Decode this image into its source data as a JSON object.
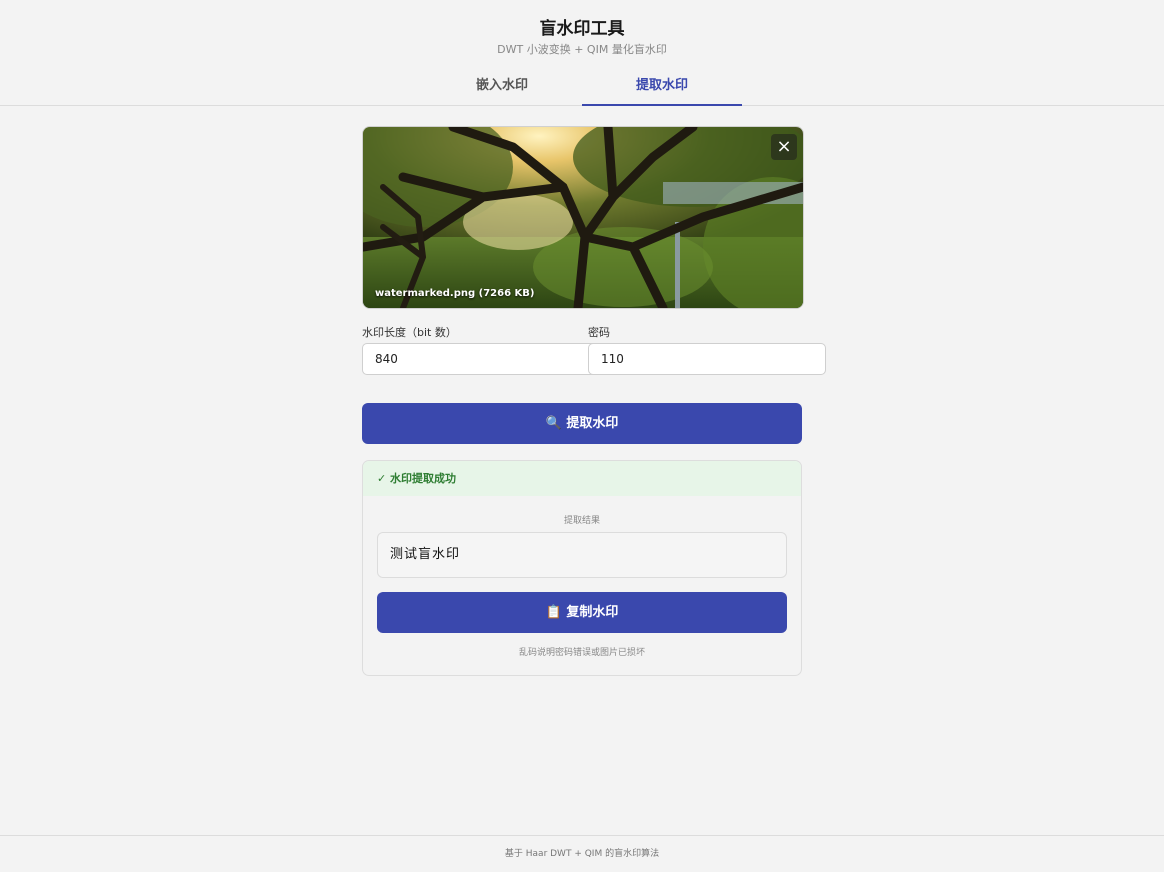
{
  "header": {
    "title": "盲水印工具",
    "subtitle": "DWT 小波变换 + QIM 量化盲水印"
  },
  "tabs": [
    {
      "label": "嵌入水印",
      "active": false
    },
    {
      "label": "提取水印",
      "active": true
    }
  ],
  "image": {
    "caption": "watermarked.png (7266 KB)",
    "close_icon": "close-icon"
  },
  "fields": {
    "length_label": "水印长度（bit 数）",
    "length_value": "840",
    "password_label": "密码",
    "password_value": "110"
  },
  "extract_button": {
    "icon": "magnifier-icon",
    "label": "提取水印"
  },
  "result": {
    "status": "✓ 水印提取成功",
    "label": "提取结果",
    "value": "测试盲水印",
    "copy_icon": "clipboard-icon",
    "copy_label": "复制水印",
    "hint": "乱码说明密码错误或图片已损坏"
  },
  "footer": {
    "text": "基于 Haar DWT + QIM 的盲水印算法"
  },
  "colors": {
    "accent": "#3a48ad",
    "success_bg": "#e7f5e8",
    "success_text": "#2e7d32"
  }
}
